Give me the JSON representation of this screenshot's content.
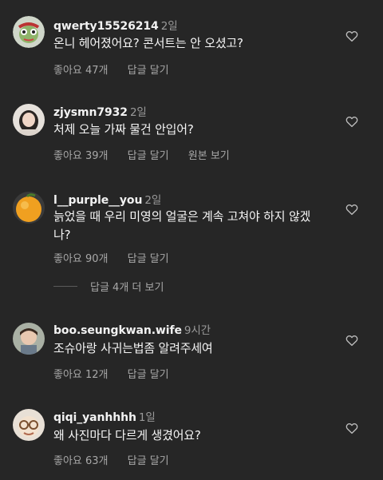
{
  "comments": [
    {
      "username": "qwerty15526214",
      "time": "2일",
      "text": "온니 헤어졌어요? 콘서트는 안 오셨고?",
      "likes": "좋아요 47개",
      "reply": "답글 달기",
      "original": ""
    },
    {
      "username": "zjysmn7932",
      "time": "2일",
      "text": "처제 오늘 가짜 물건 안입어?",
      "likes": "좋아요 39개",
      "reply": "답글 달기",
      "original": "원본 보기"
    },
    {
      "username": "l__purple__you",
      "time": "2일",
      "text": "늙었을 때 우리 미영의 얼굴은 계속 고쳐야 하지 않겠나?",
      "likes": "좋아요 90개",
      "reply": "답글 달기",
      "original": ""
    },
    {
      "username": "boo.seungkwan.wife",
      "time": "9시간",
      "text": "조슈아랑 사귀는법좀 알려주세여",
      "likes": "좋아요 12개",
      "reply": "답글 달기",
      "original": ""
    },
    {
      "username": "qiqi_yanhhhh",
      "time": "1일",
      "text": "왜 사진마다 다르게 생겼어요?",
      "likes": "좋아요 63개",
      "reply": "답글 달기",
      "original": ""
    }
  ],
  "view_replies": "답글 4개 더 보기",
  "icons": {
    "like": "heart-outline-icon"
  },
  "colors": {
    "background": "#262626",
    "secondary_text": "#a8a8a8"
  }
}
